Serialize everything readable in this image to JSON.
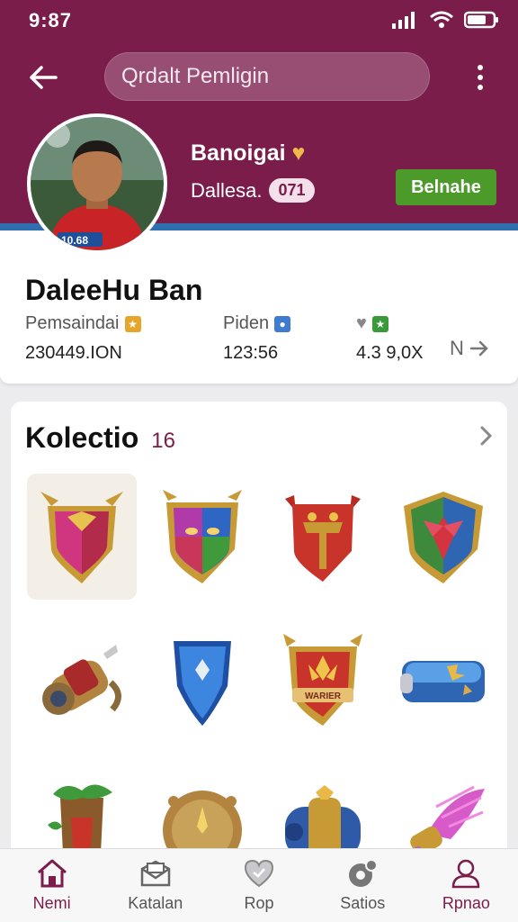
{
  "status_bar": {
    "time": "9:87"
  },
  "header": {
    "search_placeholder": "Qrdalt Pemligin",
    "player_name": "Banoigai",
    "player_sub": "Dallesa.",
    "player_badge": "071",
    "action_button": "Belnahe",
    "avatar_badge": "10.68"
  },
  "profile": {
    "title": "DaleeHu Ban",
    "stats": [
      {
        "label": "Pemsaindai",
        "value": "230449.ION"
      },
      {
        "label": "Piden",
        "value": "123:56"
      },
      {
        "label": "",
        "value": "4.3 9,0X"
      }
    ],
    "more_label": "N"
  },
  "collection": {
    "title": "Kolectio",
    "count": "16"
  },
  "nav": [
    {
      "label": "Nemi",
      "icon": "home-icon",
      "active": true
    },
    {
      "label": "Katalan",
      "icon": "catalog-icon",
      "active": false
    },
    {
      "label": "Rop",
      "icon": "heart-icon",
      "active": false
    },
    {
      "label": "Satios",
      "icon": "settings-icon",
      "active": false
    },
    {
      "label": "Rpnao",
      "icon": "profile-icon",
      "active": true
    }
  ],
  "colors": {
    "brand": "#7a1d4b",
    "accent_stripe": "#2f6fb0",
    "action_green": "#4c9a2a"
  }
}
